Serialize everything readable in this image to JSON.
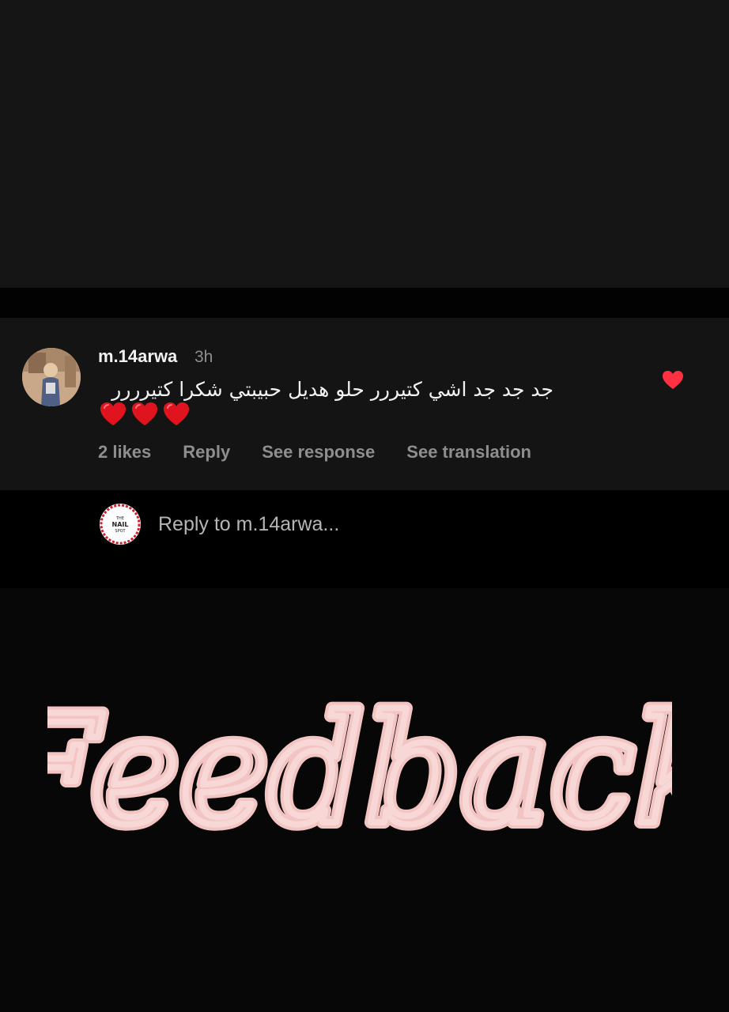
{
  "comment": {
    "username": "m.14arwa",
    "time": "3h",
    "text": "جد جد جد اشي كتيررر حلو هديل حبيبتي شكرا كتيرررر",
    "emoji": [
      "red-heart-emoji",
      "red-heart-emoji",
      "red-heart-emoji"
    ],
    "liked": true,
    "actions": {
      "likes": "2 likes",
      "reply": "Reply",
      "see_response": "See response",
      "see_translation": "See translation"
    }
  },
  "reply_box": {
    "placeholder": "Reply to m.14arwa..."
  },
  "shop_avatar": {
    "logo_text_top": "THE",
    "logo_text_main": "NAIL",
    "logo_text_bottom": "SPOT"
  },
  "overlay": {
    "caption": "Feedback"
  },
  "colors": {
    "background_top": "#151515",
    "comment_bg": "#141414",
    "reply_bar_bg": "#000000",
    "heart_red": "#ff3040",
    "feedback_pink": "#f2c4c2",
    "muted_text": "#8e8e8e"
  }
}
